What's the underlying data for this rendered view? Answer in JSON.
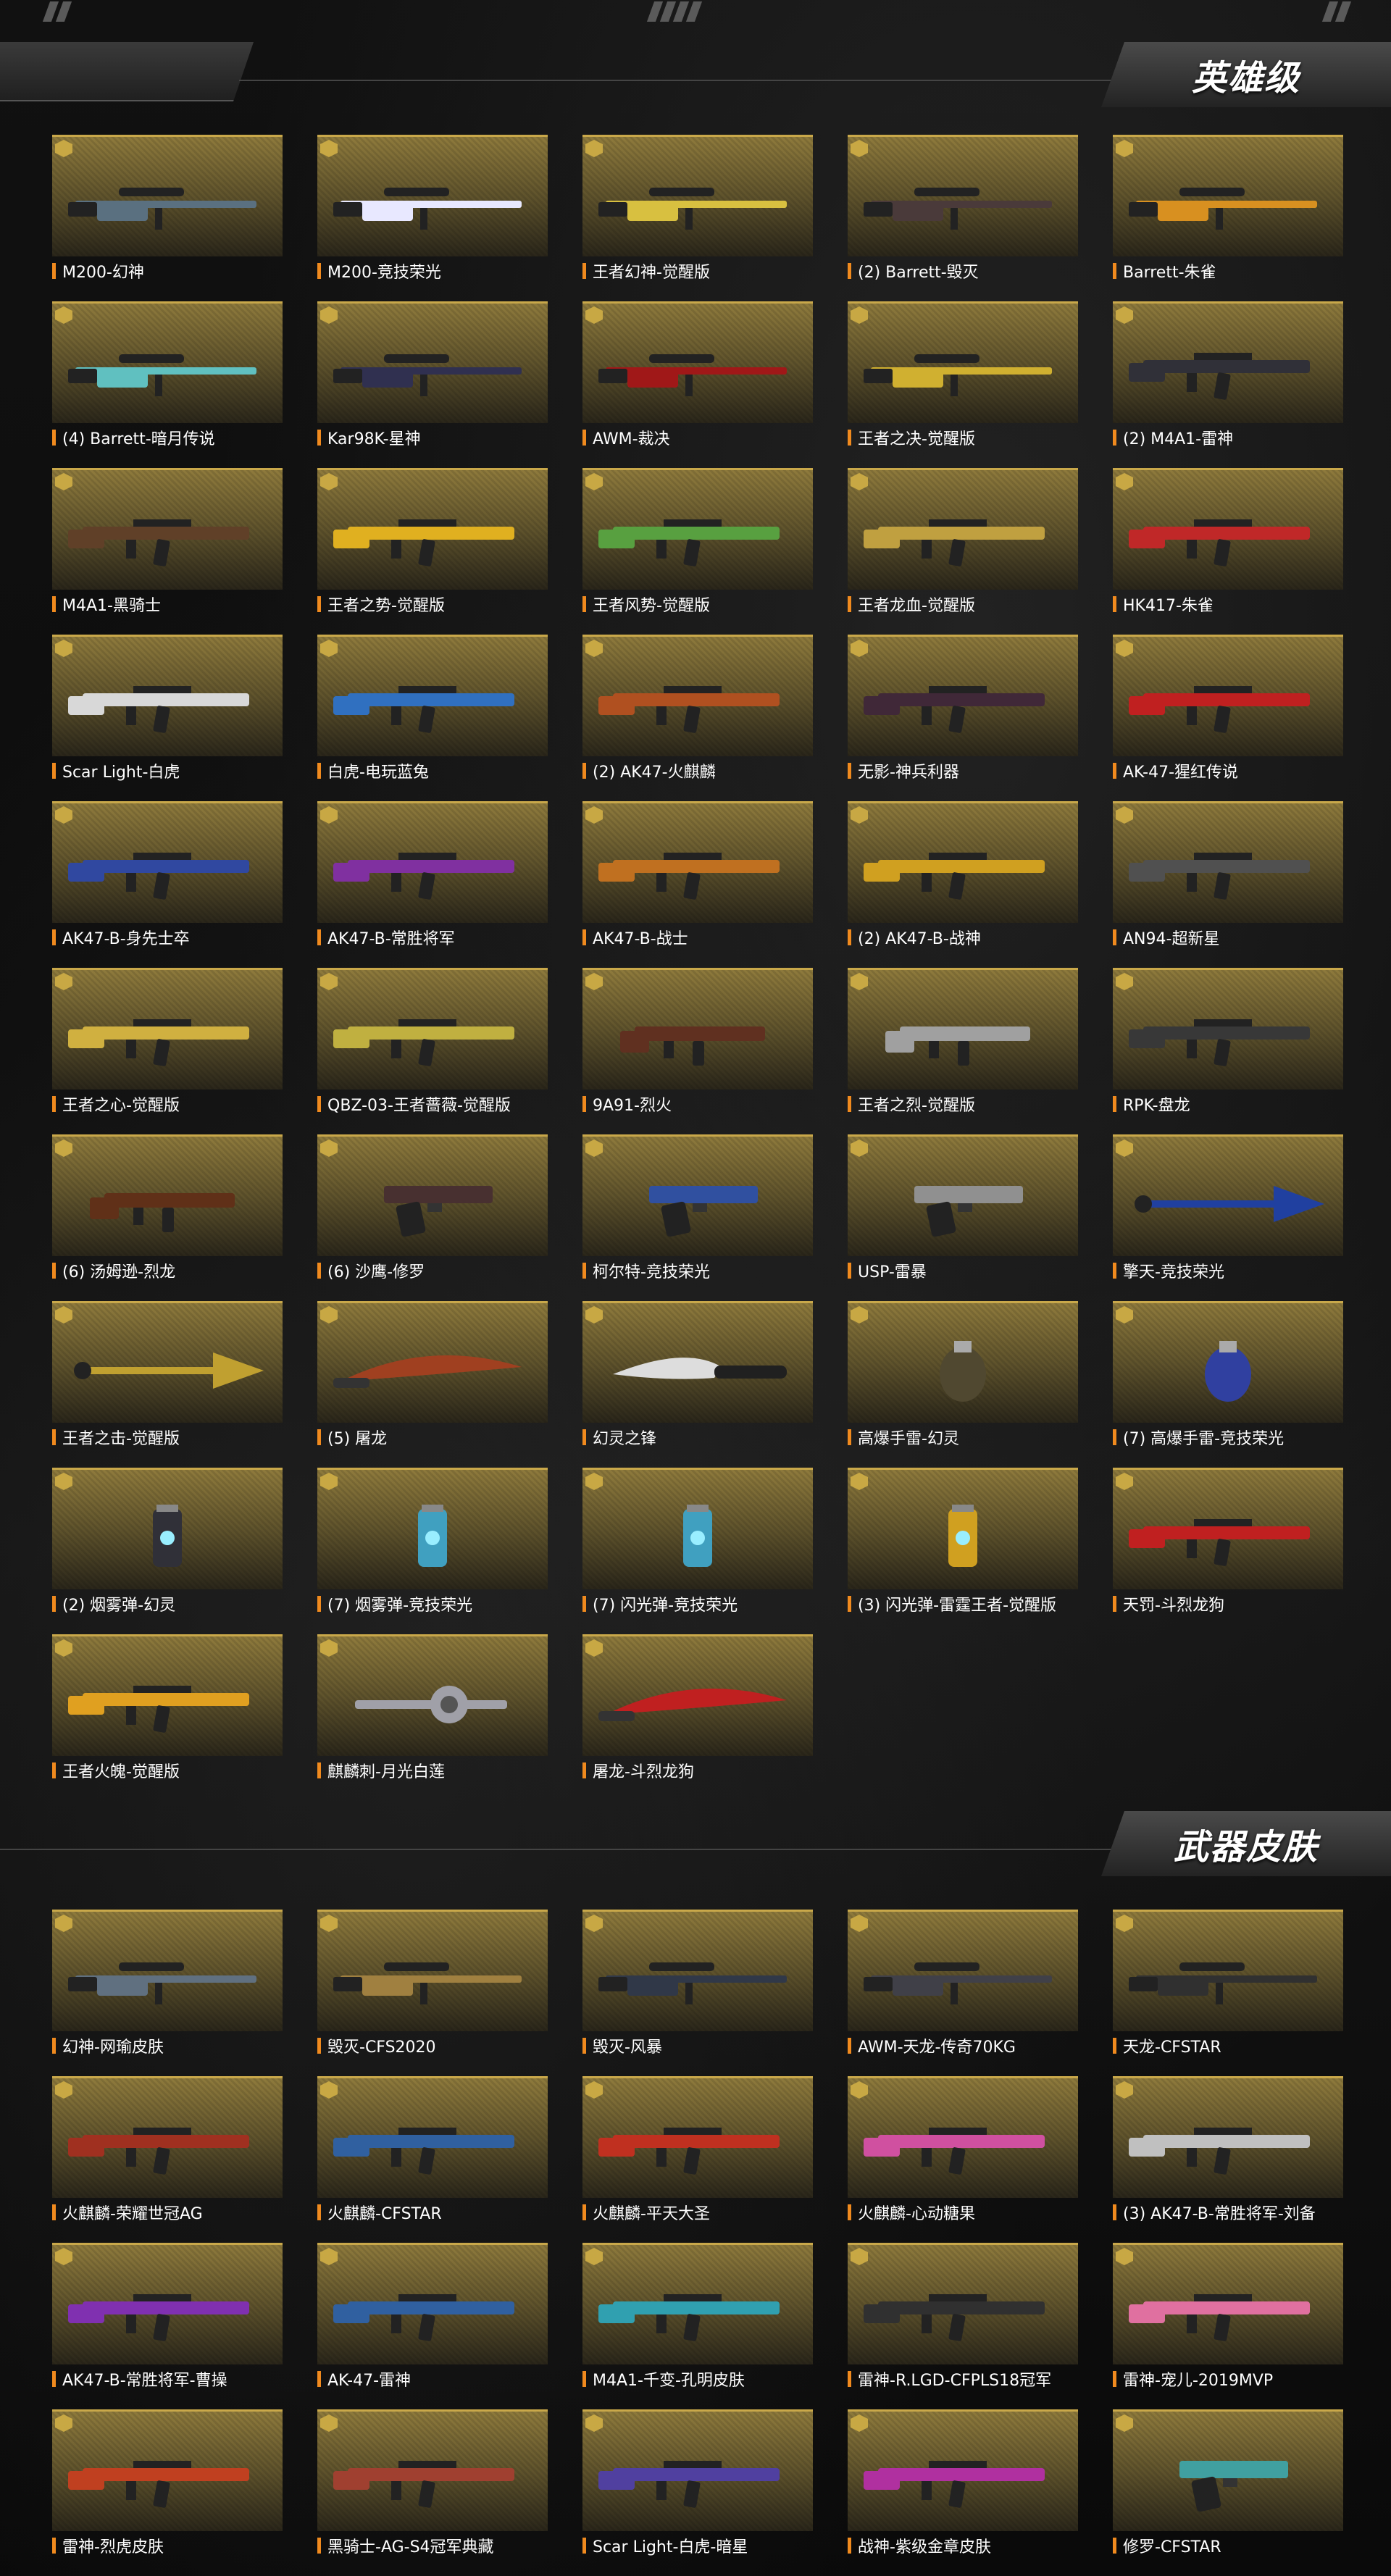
{
  "sections": [
    {
      "title": "英雄级",
      "items": [
        {
          "label": "M200-幻神",
          "icon": "sniper-rifle-icon",
          "color": "#5a7080"
        },
        {
          "label": "M200-竞技荣光",
          "icon": "sniper-rifle-icon",
          "color": "#e8e8ff"
        },
        {
          "label": "王者幻神-觉醒版",
          "icon": "sniper-rifle-icon",
          "color": "#d8c040"
        },
        {
          "label": "(2) Barrett-毁灭",
          "icon": "sniper-rifle-icon",
          "color": "#4a3a3a"
        },
        {
          "label": "Barrett-朱雀",
          "icon": "sniper-rifle-icon",
          "color": "#d89020"
        },
        {
          "label": "(4) Barrett-暗月传说",
          "icon": "sniper-rifle-icon",
          "color": "#60c0c0"
        },
        {
          "label": "Kar98K-星神",
          "icon": "sniper-rifle-icon",
          "color": "#303050"
        },
        {
          "label": "AWM-裁决",
          "icon": "sniper-rifle-icon",
          "color": "#a01818"
        },
        {
          "label": "王者之决-觉醒版",
          "icon": "sniper-rifle-icon",
          "color": "#d0b030"
        },
        {
          "label": "(2) M4A1-雷神",
          "icon": "assault-rifle-icon",
          "color": "#303038"
        },
        {
          "label": "M4A1-黑骑士",
          "icon": "assault-rifle-icon",
          "color": "#604028"
        },
        {
          "label": "王者之势-觉醒版",
          "icon": "assault-rifle-icon",
          "color": "#e0b020"
        },
        {
          "label": "王者风势-觉醒版",
          "icon": "assault-rifle-icon",
          "color": "#58a040"
        },
        {
          "label": "王者龙血-觉醒版",
          "icon": "assault-rifle-icon",
          "color": "#c0a040"
        },
        {
          "label": "HK417-朱雀",
          "icon": "assault-rifle-icon",
          "color": "#c02828"
        },
        {
          "label": "Scar Light-白虎",
          "icon": "assault-rifle-icon",
          "color": "#d8d8d8"
        },
        {
          "label": "白虎-电玩蓝兔",
          "icon": "assault-rifle-icon",
          "color": "#3070c0"
        },
        {
          "label": "(2) AK47-火麒麟",
          "icon": "assault-rifle-icon",
          "color": "#b05020"
        },
        {
          "label": "无影-神兵利器",
          "icon": "assault-rifle-icon",
          "color": "#402838"
        },
        {
          "label": "AK-47-猩红传说",
          "icon": "assault-rifle-icon",
          "color": "#c02020"
        },
        {
          "label": "AK47-B-身先士卒",
          "icon": "assault-rifle-icon",
          "color": "#3048a0"
        },
        {
          "label": "AK47-B-常胜将军",
          "icon": "assault-rifle-icon",
          "color": "#8030a0"
        },
        {
          "label": "AK47-B-战士",
          "icon": "assault-rifle-icon",
          "color": "#c07020"
        },
        {
          "label": "(2) AK47-B-战神",
          "icon": "assault-rifle-icon",
          "color": "#d0a020"
        },
        {
          "label": "AN94-超新星",
          "icon": "assault-rifle-icon",
          "color": "#505050"
        },
        {
          "label": "王者之心-觉醒版",
          "icon": "assault-rifle-icon",
          "color": "#d0b040"
        },
        {
          "label": "QBZ-03-王者蔷薇-觉醒版",
          "icon": "assault-rifle-icon",
          "color": "#c0b040"
        },
        {
          "label": "9A91-烈火",
          "icon": "smg-icon",
          "color": "#603020"
        },
        {
          "label": "王者之烈-觉醒版",
          "icon": "smg-icon",
          "color": "#a0a0a0"
        },
        {
          "label": "RPK-盘龙",
          "icon": "assault-rifle-icon",
          "color": "#383838"
        },
        {
          "label": "(6) 汤姆逊-烈龙",
          "icon": "smg-icon",
          "color": "#603018"
        },
        {
          "label": "(6) 沙鹰-修罗",
          "icon": "pistol-icon",
          "color": "#483030"
        },
        {
          "label": "柯尔特-竞技荣光",
          "icon": "pistol-icon",
          "color": "#3050a0"
        },
        {
          "label": "USP-雷暴",
          "icon": "pistol-icon",
          "color": "#909090"
        },
        {
          "label": "擎天-竞技荣光",
          "icon": "shovel-icon",
          "color": "#2040a0"
        },
        {
          "label": "王者之击-觉醒版",
          "icon": "shovel-icon",
          "color": "#c0a030"
        },
        {
          "label": "(5) 屠龙",
          "icon": "blade-icon",
          "color": "#a04020"
        },
        {
          "label": "幻灵之锋",
          "icon": "knife-icon",
          "color": "#202020"
        },
        {
          "label": "高爆手雷-幻灵",
          "icon": "grenade-icon",
          "color": "#504830"
        },
        {
          "label": "(7) 高爆手雷-竞技荣光",
          "icon": "grenade-icon",
          "color": "#3040a0"
        },
        {
          "label": "(2) 烟雾弹-幻灵",
          "icon": "canister-icon",
          "color": "#303038"
        },
        {
          "label": "(7) 烟雾弹-竞技荣光",
          "icon": "canister-icon",
          "color": "#40a0c0"
        },
        {
          "label": "(7) 闪光弹-竞技荣光",
          "icon": "canister-icon",
          "color": "#40a0c0"
        },
        {
          "label": "(3) 闪光弹-雷霆王者-觉醒版",
          "icon": "canister-icon",
          "color": "#d0a020"
        },
        {
          "label": "天罚-斗烈龙狗",
          "icon": "assault-rifle-icon",
          "color": "#c02020"
        },
        {
          "label": "王者火魄-觉醒版",
          "icon": "assault-rifle-icon",
          "color": "#e0a020"
        },
        {
          "label": "麒麟刺-月光白莲",
          "icon": "claw-icon",
          "color": "#a0a0a8"
        },
        {
          "label": "屠龙-斗烈龙狗",
          "icon": "blade-icon",
          "color": "#c02020"
        }
      ]
    },
    {
      "title": "武器皮肤",
      "items": [
        {
          "label": "幻神-网瑜皮肤",
          "icon": "sniper-rifle-icon",
          "color": "#607080"
        },
        {
          "label": "毁灭-CFS2020",
          "icon": "sniper-rifle-icon",
          "color": "#a08040"
        },
        {
          "label": "毁灭-风暴",
          "icon": "sniper-rifle-icon",
          "color": "#303848"
        },
        {
          "label": "AWM-天龙-传奇70KG",
          "icon": "sniper-rifle-icon",
          "color": "#404048"
        },
        {
          "label": "天龙-CFSTAR",
          "icon": "sniper-rifle-icon",
          "color": "#303030"
        },
        {
          "label": "火麒麟-荣耀世冠AG",
          "icon": "assault-rifle-icon",
          "color": "#a03020"
        },
        {
          "label": "火麒麟-CFSTAR",
          "icon": "assault-rifle-icon",
          "color": "#3060a0"
        },
        {
          "label": "火麒麟-平天大圣",
          "icon": "assault-rifle-icon",
          "color": "#c03020"
        },
        {
          "label": "火麒麟-心动糖果",
          "icon": "assault-rifle-icon",
          "color": "#d050a0"
        },
        {
          "label": "(3) AK47-B-常胜将军-刘备",
          "icon": "assault-rifle-icon",
          "color": "#c0c0c0"
        },
        {
          "label": "AK47-B-常胜将军-曹操",
          "icon": "assault-rifle-icon",
          "color": "#8030b0"
        },
        {
          "label": "AK-47-雷神",
          "icon": "assault-rifle-icon",
          "color": "#3060a0"
        },
        {
          "label": "M4A1-千变-孔明皮肤",
          "icon": "assault-rifle-icon",
          "color": "#30a0b0"
        },
        {
          "label": "雷神-R.LGD-CFPLS18冠军",
          "icon": "assault-rifle-icon",
          "color": "#303030"
        },
        {
          "label": "雷神-宠儿-2019MVP",
          "icon": "assault-rifle-icon",
          "color": "#e070a0"
        },
        {
          "label": "雷神-烈虎皮肤",
          "icon": "assault-rifle-icon",
          "color": "#c04020"
        },
        {
          "label": "黑骑士-AG-S4冠军典藏",
          "icon": "assault-rifle-icon",
          "color": "#a04030"
        },
        {
          "label": "Scar Light-白虎-暗星",
          "icon": "assault-rifle-icon",
          "color": "#5040a0"
        },
        {
          "label": "战神-紫级金章皮肤",
          "icon": "assault-rifle-icon",
          "color": "#b030a0"
        },
        {
          "label": "修罗-CFSTAR",
          "icon": "pistol-icon",
          "color": "#40a0a0"
        }
      ]
    }
  ],
  "deco": {
    "top_left": "//",
    "top_center": "////",
    "top_right": "//"
  }
}
